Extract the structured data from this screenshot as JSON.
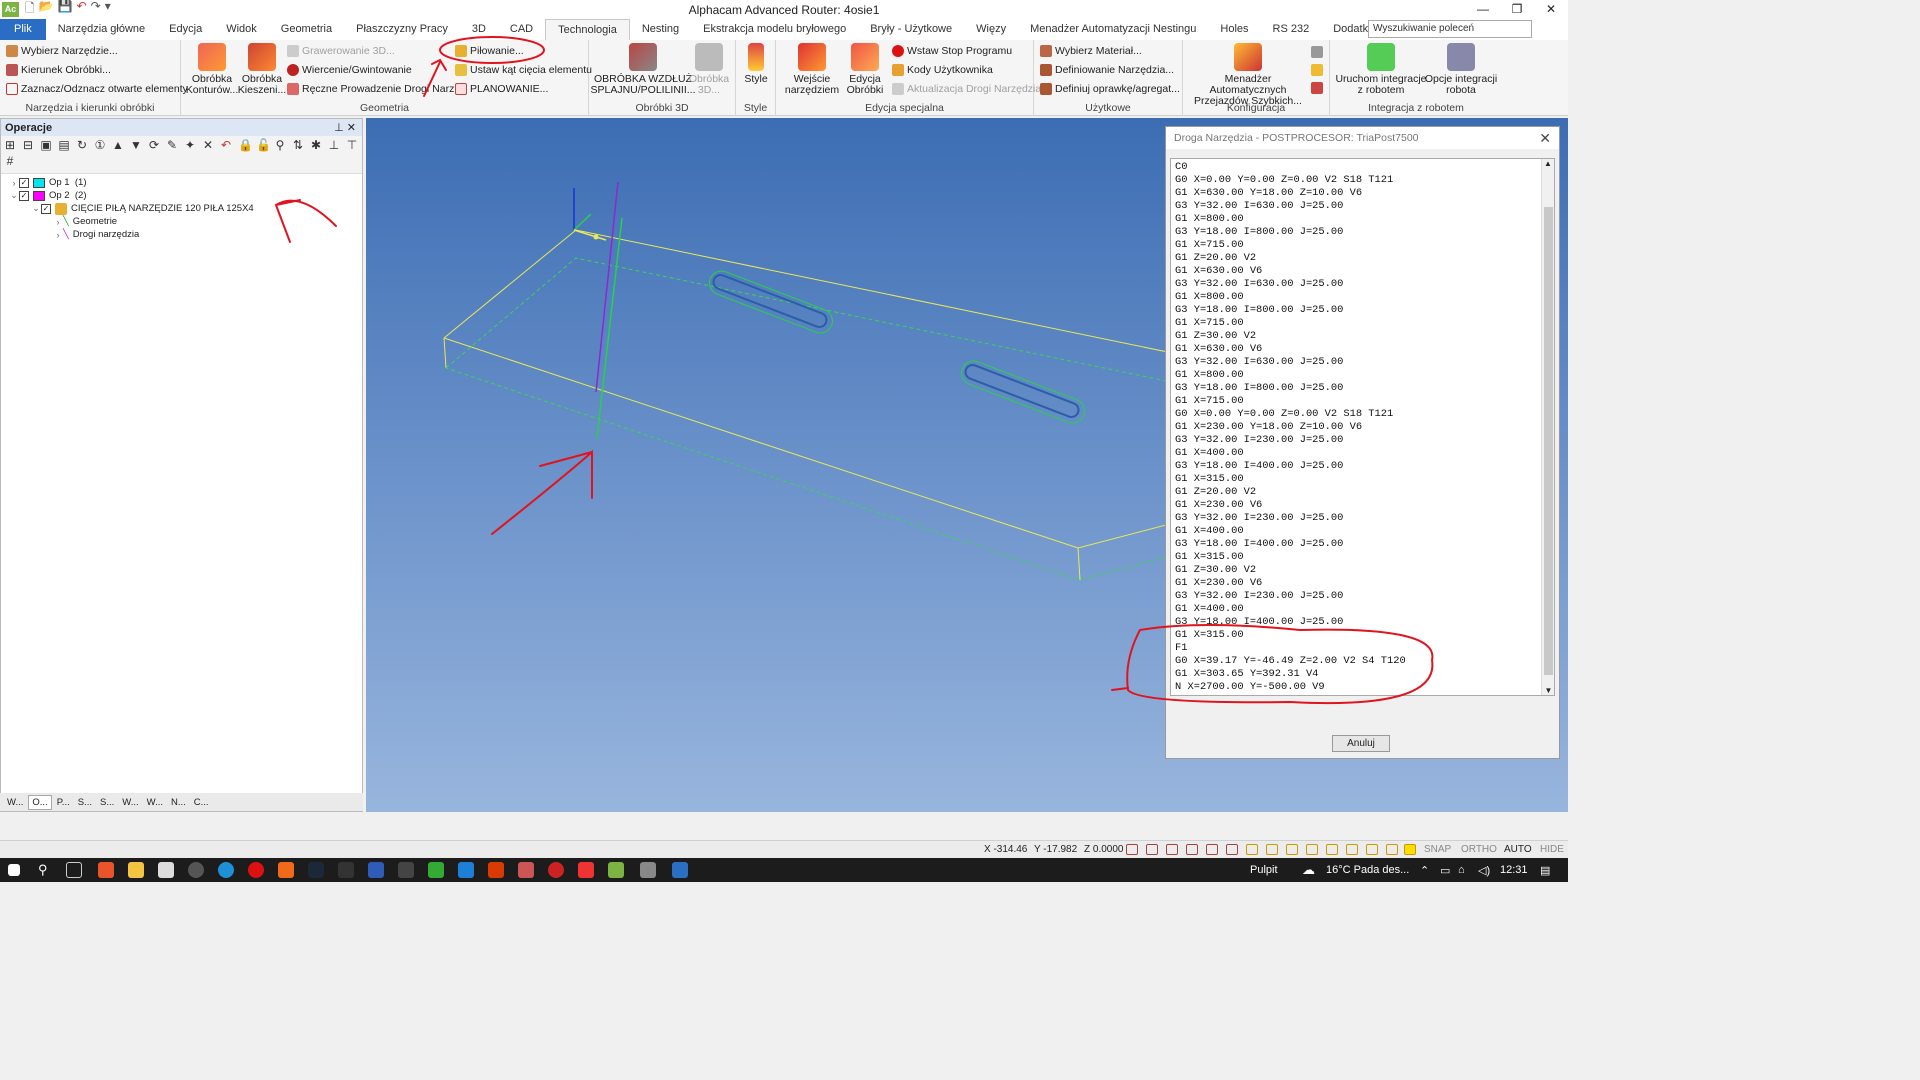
{
  "app": {
    "icon_text": "Ac",
    "title": "Alphacam Advanced Router: 4osie1",
    "window_controls": [
      "—",
      "❐",
      "✕"
    ]
  },
  "ribbon_tabs": [
    "Plik",
    "Narzędzia główne",
    "Edycja",
    "Widok",
    "Geometria",
    "Płaszczyzny Pracy",
    "3D",
    "CAD",
    "Technologia",
    "Nesting",
    "Ekstrakcja modelu bryłowego",
    "Bryły - Użytkowe",
    "Więzy",
    "Menadżer Automatyzacji Nestingu",
    "Holes",
    "RS 232",
    "Dodatki/makra"
  ],
  "search": {
    "placeholder": "Wyszukiwanie poleceń"
  },
  "groups": {
    "g1": {
      "label": "Narzędzia i kierunki obróbki",
      "items": [
        "Wybierz Narzędzie...",
        "Kierunek Obróbki...",
        "Zaznacz/Odznacz otwarte elementy"
      ]
    },
    "g2": {
      "label": "Geometria",
      "big1": "Obróbka Konturów...",
      "big2": "Obróbka Kieszeni...",
      "items": [
        "Grawerowanie 3D...",
        "Wiercenie/Gwintowanie",
        "Ręczne Prowadzenie Drogi Narz...",
        "Piłowanie...",
        "Ustaw kąt cięcia elementu",
        "PLANOWANIE..."
      ]
    },
    "g3": {
      "label": "Obróbki 3D",
      "big1": "OBRÓBKA WZDŁUŻ SPLAJNU/POLILINII...",
      "big2": "Obróbka 3D..."
    },
    "g4": {
      "label": "Style",
      "big1": "Style"
    },
    "g5": {
      "label": "Edycja specjalna",
      "big1": "Wejście narzędziem",
      "big2": "Edycja Obróbki",
      "items": [
        "Wstaw Stop Programu",
        "Kody Użytkownika",
        "Aktualizacja Drogi Narzędzia"
      ]
    },
    "g6": {
      "label": "Użytkowe",
      "items": [
        "Wybierz Materiał...",
        "Definiowanie Narzędzia...",
        "Definiuj oprawkę/agregat..."
      ]
    },
    "g7": {
      "label": "Konfiguracja",
      "big1": "Menadżer Automatycznych Przejazdów Szybkich..."
    },
    "g8": {
      "label": "Integracja z robotem",
      "big1": "Uruchom integracje z robotem",
      "big2": "Opcje integracji robota"
    }
  },
  "operations_panel": {
    "title": "Operacje",
    "tree": [
      {
        "name": "Op 1",
        "count": "(1)",
        "color": "#00e5ee"
      },
      {
        "name": "Op 2",
        "count": "(2)",
        "color": "#ff00ff"
      },
      {
        "name": "CIĘCIE PIŁĄ  NARZĘDZIE 120  PIŁA 125X4"
      },
      {
        "name": "Geometrie"
      },
      {
        "name": "Drogi narzędzia"
      }
    ],
    "bottom_tabs": [
      "W...",
      "O...",
      "P...",
      "S...",
      "S...",
      "W...",
      "W...",
      "N...",
      "C..."
    ]
  },
  "dialog": {
    "title": "Droga Narzędzia - POSTPROCESOR: TriaPost7500",
    "code": "C0\nG0 X=0.00 Y=0.00 Z=0.00 V2 S18 T121\nG1 X=630.00 Y=18.00 Z=10.00 V6\nG3 Y=32.00 I=630.00 J=25.00\nG1 X=800.00\nG3 Y=18.00 I=800.00 J=25.00\nG1 X=715.00\nG1 Z=20.00 V2\nG1 X=630.00 V6\nG3 Y=32.00 I=630.00 J=25.00\nG1 X=800.00\nG3 Y=18.00 I=800.00 J=25.00\nG1 X=715.00\nG1 Z=30.00 V2\nG1 X=630.00 V6\nG3 Y=32.00 I=630.00 J=25.00\nG1 X=800.00\nG3 Y=18.00 I=800.00 J=25.00\nG1 X=715.00\nG0 X=0.00 Y=0.00 Z=0.00 V2 S18 T121\nG1 X=230.00 Y=18.00 Z=10.00 V6\nG3 Y=32.00 I=230.00 J=25.00\nG1 X=400.00\nG3 Y=18.00 I=400.00 J=25.00\nG1 X=315.00\nG1 Z=20.00 V2\nG1 X=230.00 V6\nG3 Y=32.00 I=230.00 J=25.00\nG1 X=400.00\nG3 Y=18.00 I=400.00 J=25.00\nG1 X=315.00\nG1 Z=30.00 V2\nG1 X=230.00 V6\nG3 Y=32.00 I=230.00 J=25.00\nG1 X=400.00\nG3 Y=18.00 I=400.00 J=25.00\nG1 X=315.00\nF1\nG0 X=39.17 Y=-46.49 Z=2.00 V2 S4 T120\nG1 X=303.65 Y=392.31 V4\nN X=2700.00 Y=-500.00 V9",
    "cancel": "Anuluj"
  },
  "status": {
    "x": "X -314.46",
    "y": "Y -17.982",
    "z": "Z 0.0000",
    "modes": [
      "SNAP",
      "ORTHO",
      "AUTO",
      "HIDE"
    ]
  },
  "taskbar": {
    "weather": "16°C  Pada des...",
    "pulpit": "Pulpit",
    "time": "12:31"
  },
  "colors": {
    "accent": "#2b6cc4",
    "annotation": "#e0141e",
    "part_outline": "#e8e85a",
    "toolpath": "#2ad04a",
    "viewport_top": "#3c6db3",
    "viewport_bottom": "#98b5dd"
  }
}
